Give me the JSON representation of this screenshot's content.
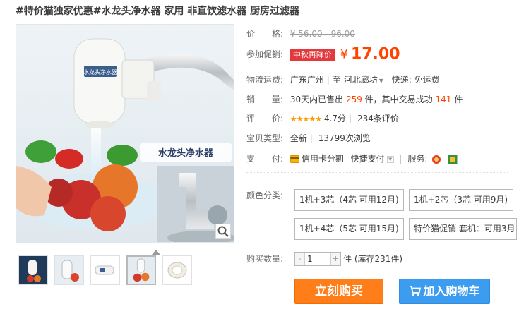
{
  "product": {
    "title": "#特价猫独家优惠#水龙头净水器 家用 非直饮滤水器 厨房过滤器",
    "image_caption": "水龙头净水器",
    "image_device_label": "水龙头净水器"
  },
  "price": {
    "label": "价　　格:",
    "original": "¥ 56.00 - 96.00"
  },
  "promotion": {
    "label": "参加促销:",
    "badge": "中秋再降价",
    "currency": "¥",
    "amount": "17.00"
  },
  "shipping": {
    "label": "物流运费:",
    "from": "广东广州",
    "to_prefix": "至",
    "to": "河北廊坊",
    "fee": "快递: 免运费"
  },
  "sales": {
    "label": "销　　量:",
    "prefix": "30天内已售出",
    "sold": "259",
    "middle": "件，其中交易成功",
    "success": "141",
    "suffix": "件"
  },
  "reviews": {
    "label": "评　　价:",
    "stars": "★★★★★",
    "score": "4.7分",
    "count": "234条评价"
  },
  "condition": {
    "label": "宝贝类型:",
    "type": "全新",
    "views": "13799次浏览"
  },
  "payment": {
    "label": "支　　付:",
    "credit": "信用卡分期",
    "quick": "快捷支付",
    "service_label": "服务:"
  },
  "sku": {
    "label": "颜色分类:",
    "options": [
      "1机+3芯（4芯 可用12月)",
      "1机+2芯（3芯 可用9月)",
      "1机+4芯（5芯 可用15月)",
      "特价猫促销 套机：可用3月"
    ]
  },
  "quantity": {
    "label": "购买数量:",
    "value": "1",
    "minus": "-",
    "plus": "+",
    "stock": "件 (库存231件)"
  },
  "actions": {
    "buy": "立刻购买",
    "cart": "加入购物车"
  },
  "colors": {
    "accent": "#ff4400",
    "buy": "#ff7e19",
    "cart": "#3c9df0"
  }
}
